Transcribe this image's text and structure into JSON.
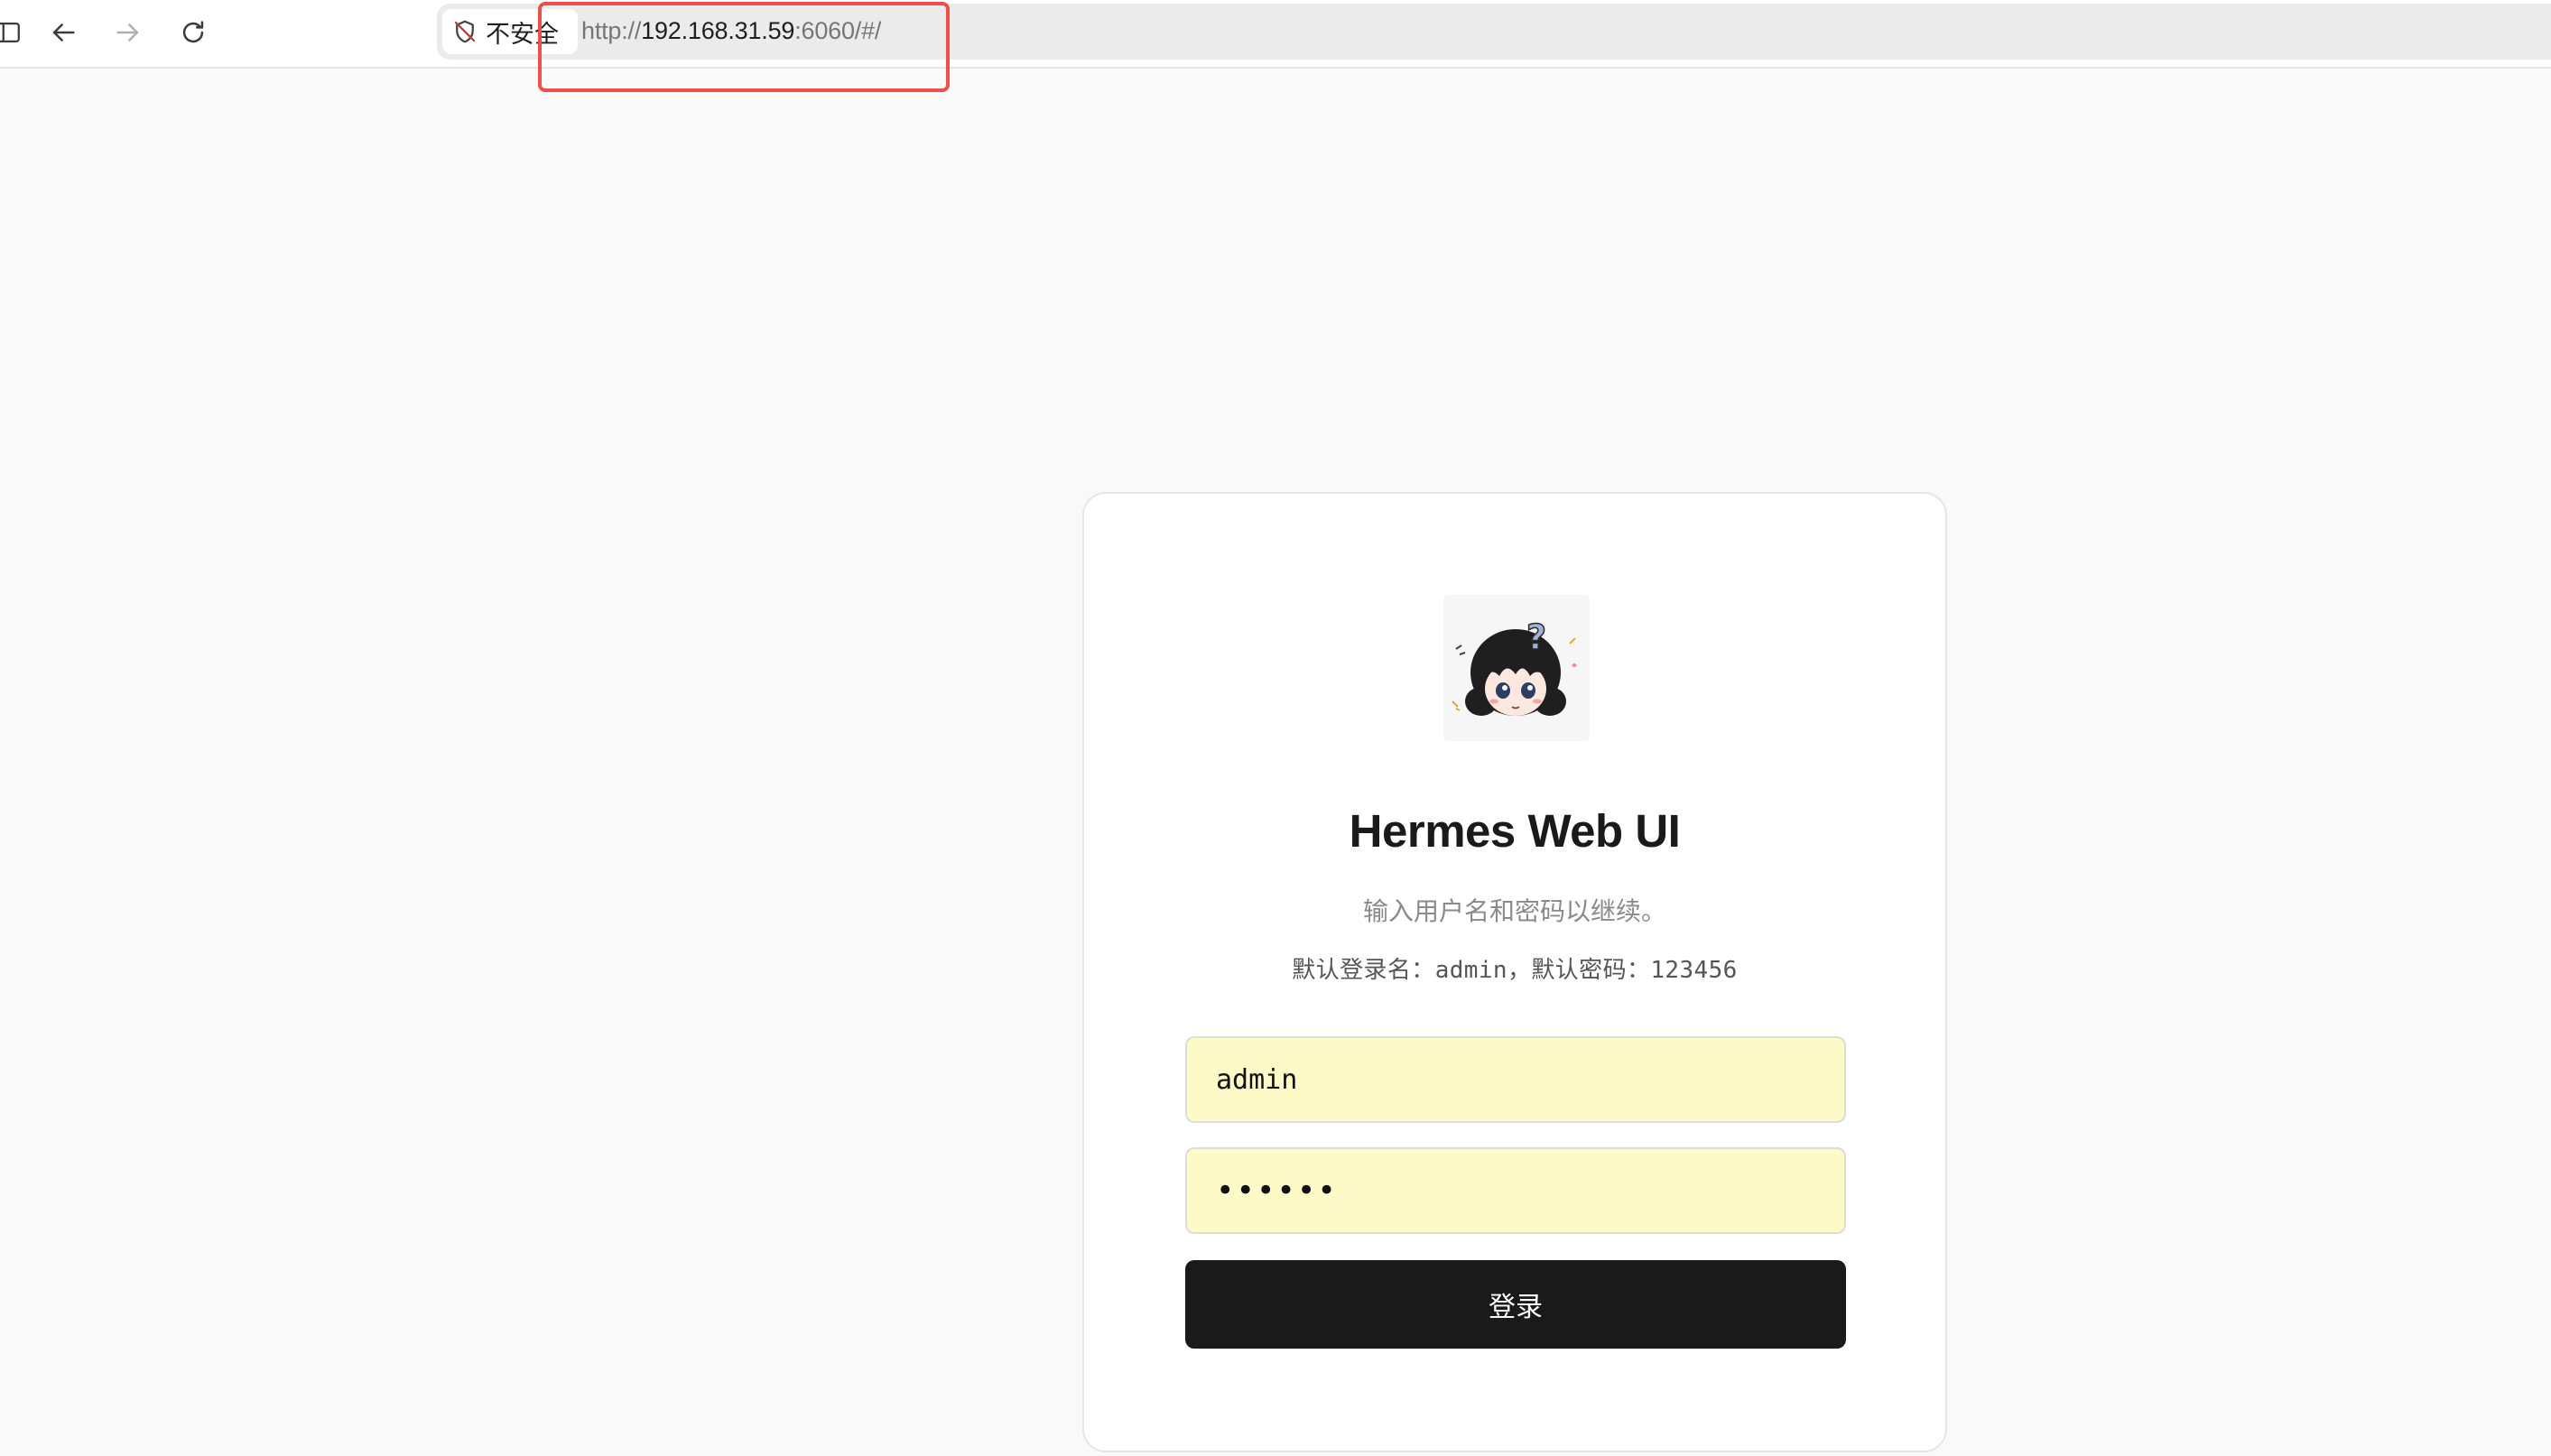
{
  "browser": {
    "security_label": "不安全",
    "url_scheme": "http://",
    "url_host": "192.168.31.59",
    "url_rest": ":6060/#/",
    "icons": {
      "sidebar": "sidebar-toggle-icon",
      "back": "arrow-left-icon",
      "forward": "arrow-right-icon",
      "reload": "reload-icon",
      "security": "shield-slash-icon"
    }
  },
  "login": {
    "logo": "anime-girl-question-mark-avatar",
    "title": "Hermes Web UI",
    "subtitle": "输入用户名和密码以继续。",
    "default_credentials": "默认登录名：admin，默认密码：123456",
    "username_value": "admin",
    "password_value": "••••••",
    "submit_label": "登录"
  },
  "colors": {
    "annotation_box": "#e8524a",
    "autofill_background": "#fdfac7",
    "button_background": "#1a1a1a",
    "page_background": "#f9f9f9"
  }
}
